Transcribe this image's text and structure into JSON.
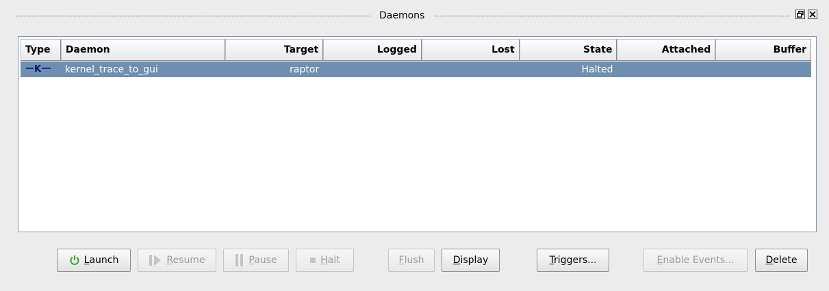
{
  "window": {
    "title": "Daemons",
    "float_icon": "restore-icon",
    "close_icon": "close-icon"
  },
  "table": {
    "columns": [
      "Type",
      "Daemon",
      "Target",
      "Logged",
      "Lost",
      "State",
      "Attached",
      "Buffer"
    ],
    "rows": [
      {
        "type_icon": "kernel-daemon-icon",
        "type_glyph": "—K—",
        "daemon": "kernel_trace_to_gui",
        "target": "raptor",
        "logged": "",
        "lost": "",
        "state": "Halted",
        "attached": "",
        "buffer": "",
        "selected": true
      }
    ]
  },
  "buttons": {
    "launch": {
      "mnemonic": "L",
      "rest": "aunch",
      "icon": "power-icon",
      "enabled": true
    },
    "resume": {
      "mnemonic": "R",
      "rest": "esume",
      "icon": "resume-icon",
      "enabled": false
    },
    "pause": {
      "mnemonic": "P",
      "rest": "ause",
      "icon": "pause-icon",
      "enabled": false
    },
    "halt": {
      "mnemonic": "H",
      "rest": "alt",
      "icon": "stop-icon",
      "enabled": false
    },
    "flush": {
      "mnemonic": "F",
      "rest": "lush",
      "enabled": false
    },
    "display": {
      "mnemonic": "D",
      "rest": "isplay",
      "enabled": true
    },
    "triggers": {
      "mnemonic": "T",
      "rest": "riggers...",
      "enabled": true
    },
    "enable_events": {
      "mnemonic": "E",
      "rest": "nable Events...",
      "enabled": false
    },
    "delete": {
      "mnemonic": "D",
      "rest": "elete",
      "enabled": true
    }
  },
  "colors": {
    "selection": "#6e8fb0",
    "frame_border": "#7d98b5",
    "launch_icon": "#2aa52a"
  }
}
